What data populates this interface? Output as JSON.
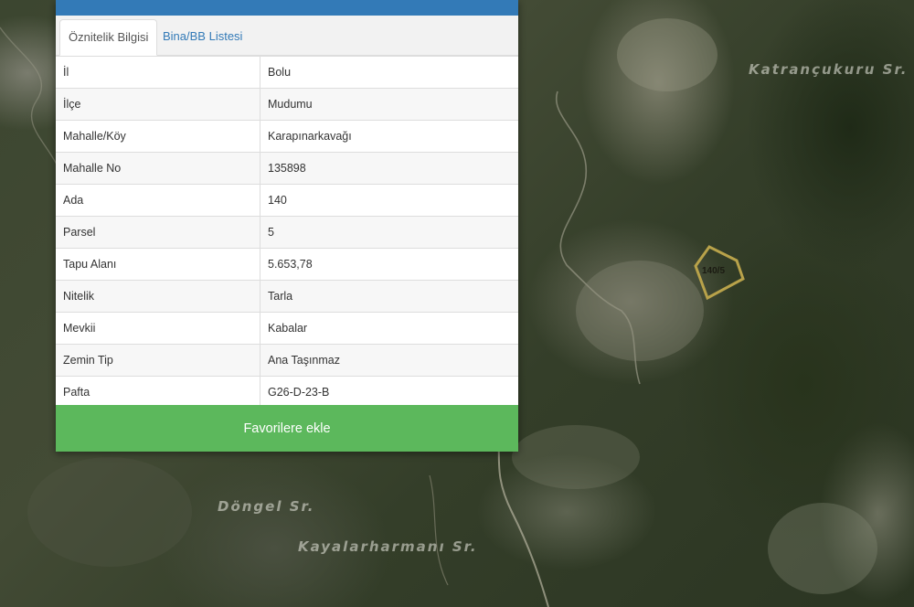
{
  "panel": {
    "header_title": "",
    "tabs": [
      {
        "label": "Öznitelik Bilgisi",
        "active": true
      },
      {
        "label": "Bina/BB Listesi",
        "active": false
      }
    ],
    "rows": [
      {
        "key": "İl",
        "value": "Bolu"
      },
      {
        "key": "İlçe",
        "value": "Mudumu"
      },
      {
        "key": "Mahalle/Köy",
        "value": "Karapınarkavağı"
      },
      {
        "key": "Mahalle No",
        "value": "135898"
      },
      {
        "key": "Ada",
        "value": "140"
      },
      {
        "key": "Parsel",
        "value": "5"
      },
      {
        "key": "Tapu Alanı",
        "value": "5.653,78"
      },
      {
        "key": "Nitelik",
        "value": "Tarla"
      },
      {
        "key": "Mevkii",
        "value": "Kabalar"
      },
      {
        "key": "Zemin Tip",
        "value": "Ana Taşınmaz"
      },
      {
        "key": "Pafta",
        "value": "G26-D-23-B"
      }
    ],
    "favorite_button": "Favorilere ekle"
  },
  "map": {
    "place_labels": [
      "Katrançukuru Sr.",
      "Döngel Sr.",
      "Kayalarharmanı Sr."
    ],
    "parcel_label": "140/5",
    "parcel_outline_color": "#b8a24a"
  },
  "colors": {
    "header_blue": "#337ab7",
    "button_green": "#5cb85c"
  }
}
